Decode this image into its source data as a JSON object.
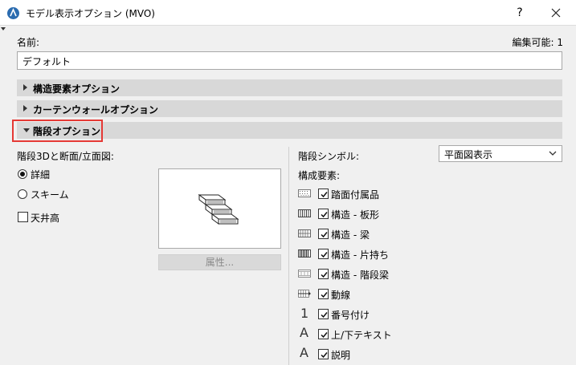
{
  "window": {
    "title": "モデル表示オプション (MVO)",
    "help": "?"
  },
  "name": {
    "label": "名前:",
    "value": "デフォルト",
    "editable": "編集可能: 1"
  },
  "sections": [
    {
      "label": "構造要素オプション",
      "expanded": false
    },
    {
      "label": "カーテンウォールオプション",
      "expanded": false
    },
    {
      "label": "階段オプション",
      "expanded": true
    }
  ],
  "stair": {
    "left_heading": "階段3Dと断面/立面図:",
    "radio_detail": "詳細",
    "radio_scheme": "スキーム",
    "ceiling": "天井高",
    "attributes_button": "属性...",
    "symbol_label": "階段シンボル:",
    "symbol_value": "平面図表示",
    "components_heading": "構成要素:",
    "components": [
      {
        "icon": "tread-accessory-pattern-icon",
        "label": "踏面付属品",
        "checked": true
      },
      {
        "icon": "structure-plate-pattern-icon",
        "label": "構造 - 板形",
        "checked": true
      },
      {
        "icon": "structure-beam-pattern-icon",
        "label": "構造 - 梁",
        "checked": true
      },
      {
        "icon": "structure-cantilever-pattern-icon",
        "label": "構造 - 片持ち",
        "checked": true
      },
      {
        "icon": "structure-stringer-pattern-icon",
        "label": "構造 - 階段梁",
        "checked": true
      },
      {
        "icon": "walking-line-icon",
        "label": "動線",
        "checked": true
      },
      {
        "icon": "numbering-icon",
        "label": "番号付け",
        "checked": true,
        "glyph": "1"
      },
      {
        "icon": "text-up-down-icon",
        "label": "上/下テキスト",
        "checked": true,
        "glyph": "A"
      },
      {
        "icon": "description-text-icon",
        "label": "説明",
        "checked": true,
        "glyph": "A"
      }
    ]
  }
}
